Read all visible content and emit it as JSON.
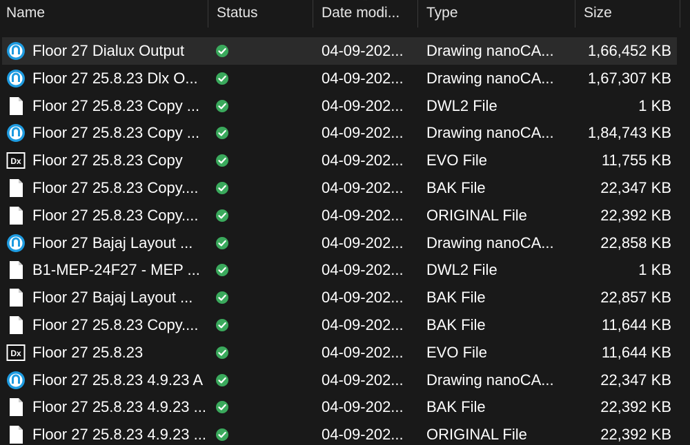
{
  "columns": {
    "name": "Name",
    "status": "Status",
    "date": "Date modi...",
    "type": "Type",
    "size": "Size"
  },
  "colors": {
    "background": "#191919",
    "selected_row": "#2b2b2b",
    "status_ok": "#3aa95c",
    "nano_icon": "#1e9be0"
  },
  "files": [
    {
      "name": "Floor 27 Dialux Output",
      "icon": "nanocad-icon",
      "status": "synced-icon",
      "date": "04-09-202...",
      "type": "Drawing nanoCA...",
      "size": "1,66,452 KB",
      "selected": true
    },
    {
      "name": "Floor 27 25.8.23 Dlx O...",
      "icon": "nanocad-icon",
      "status": "synced-icon",
      "date": "04-09-202...",
      "type": "Drawing nanoCA...",
      "size": "1,67,307 KB"
    },
    {
      "name": "Floor 27 25.8.23 Copy ...",
      "icon": "file-icon",
      "status": "synced-icon",
      "date": "04-09-202...",
      "type": "DWL2 File",
      "size": "1 KB"
    },
    {
      "name": "Floor 27 25.8.23 Copy ...",
      "icon": "nanocad-icon",
      "status": "synced-icon",
      "date": "04-09-202...",
      "type": "Drawing nanoCA...",
      "size": "1,84,743 KB"
    },
    {
      "name": "Floor 27 25.8.23 Copy",
      "icon": "dialux-icon",
      "status": "synced-icon",
      "date": "04-09-202...",
      "type": "EVO File",
      "size": "11,755 KB"
    },
    {
      "name": "Floor 27 25.8.23 Copy....",
      "icon": "file-icon",
      "status": "synced-icon",
      "date": "04-09-202...",
      "type": "BAK File",
      "size": "22,347 KB"
    },
    {
      "name": "Floor 27 25.8.23 Copy....",
      "icon": "file-icon",
      "status": "synced-icon",
      "date": "04-09-202...",
      "type": "ORIGINAL File",
      "size": "22,392 KB"
    },
    {
      "name": "Floor 27  Bajaj Layout ...",
      "icon": "nanocad-icon",
      "status": "synced-icon",
      "date": "04-09-202...",
      "type": "Drawing nanoCA...",
      "size": "22,858 KB"
    },
    {
      "name": "B1-MEP-24F27 - MEP ...",
      "icon": "file-icon",
      "status": "synced-icon",
      "date": "04-09-202...",
      "type": "DWL2 File",
      "size": "1 KB"
    },
    {
      "name": "Floor 27  Bajaj Layout ...",
      "icon": "file-icon",
      "status": "synced-icon",
      "date": "04-09-202...",
      "type": "BAK File",
      "size": "22,857 KB"
    },
    {
      "name": "Floor 27 25.8.23 Copy....",
      "icon": "file-icon",
      "status": "synced-icon",
      "date": "04-09-202...",
      "type": "BAK File",
      "size": "11,644 KB"
    },
    {
      "name": "Floor 27 25.8.23",
      "icon": "dialux-icon",
      "status": "synced-icon",
      "date": "04-09-202...",
      "type": "EVO File",
      "size": "11,644 KB"
    },
    {
      "name": "Floor 27 25.8.23 4.9.23 A",
      "icon": "nanocad-icon",
      "status": "synced-icon",
      "date": "04-09-202...",
      "type": "Drawing nanoCA...",
      "size": "22,347 KB"
    },
    {
      "name": "Floor 27 25.8.23 4.9.23 ...",
      "icon": "file-icon",
      "status": "synced-icon",
      "date": "04-09-202...",
      "type": "BAK File",
      "size": "22,392 KB"
    },
    {
      "name": "Floor 27 25.8.23 4.9.23 ...",
      "icon": "file-icon",
      "status": "synced-icon",
      "date": "04-09-202...",
      "type": "ORIGINAL File",
      "size": "22,392 KB"
    }
  ]
}
